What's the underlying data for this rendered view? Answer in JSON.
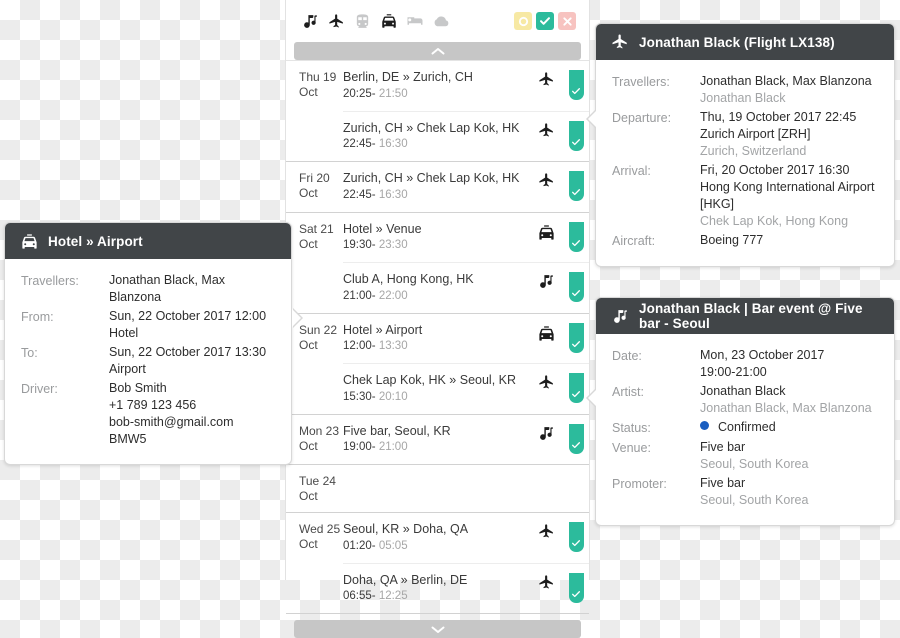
{
  "timeline": {
    "type_filters": [
      {
        "name": "music-note-icon",
        "active": true
      },
      {
        "name": "airplane-icon",
        "active": true
      },
      {
        "name": "train-icon",
        "active": false
      },
      {
        "name": "taxi-icon",
        "active": true
      },
      {
        "name": "bed-icon",
        "active": false
      },
      {
        "name": "cloud-icon",
        "active": false
      }
    ],
    "status_filters": [
      {
        "name": "pending-filter",
        "glyph": "circle",
        "color": "#f7e9a4"
      },
      {
        "name": "confirmed-filter",
        "glyph": "check",
        "color": "#2cbb9c"
      },
      {
        "name": "cancelled-filter",
        "glyph": "cross",
        "color": "#f7c3c0"
      }
    ],
    "scroll_up_label": "▲",
    "scroll_down_label": "▼",
    "days": [
      {
        "date_line1": "Thu 19",
        "date_line2": "Oct",
        "events": [
          {
            "title": "Berlin, DE » Zurich, CH",
            "time_start": "20:25-",
            "time_end": "21:50",
            "type": "airplane-icon",
            "status": "confirmed"
          },
          {
            "title": "Zurich, CH » Chek Lap Kok, HK",
            "time_start": "22:45-",
            "time_end": "16:30",
            "type": "airplane-icon",
            "status": "confirmed"
          }
        ]
      },
      {
        "date_line1": "Fri 20",
        "date_line2": "Oct",
        "events": [
          {
            "title": "Zurich, CH » Chek Lap Kok, HK",
            "time_start": "22:45-",
            "time_end": "16:30",
            "type": "airplane-icon",
            "status": "confirmed"
          }
        ]
      },
      {
        "date_line1": "Sat 21",
        "date_line2": "Oct",
        "events": [
          {
            "title": "Hotel » Venue",
            "time_start": "19:30-",
            "time_end": "23:30",
            "type": "taxi-icon",
            "status": "confirmed"
          },
          {
            "title": "Club A, Hong Kong, HK",
            "time_start": "21:00-",
            "time_end": "22:00",
            "type": "music-note-icon",
            "status": "confirmed"
          }
        ]
      },
      {
        "date_line1": "Sun 22",
        "date_line2": "Oct",
        "events": [
          {
            "title": "Hotel » Airport",
            "time_start": "12:00-",
            "time_end": "13:30",
            "type": "taxi-icon",
            "status": "confirmed"
          },
          {
            "title": "Chek Lap Kok, HK » Seoul, KR",
            "time_start": "15:30-",
            "time_end": "20:10",
            "type": "airplane-icon",
            "status": "confirmed"
          }
        ]
      },
      {
        "date_line1": "Mon 23",
        "date_line2": "Oct",
        "events": [
          {
            "title": "Five bar, Seoul, KR",
            "time_start": "19:00-",
            "time_end": "21:00",
            "type": "music-note-icon",
            "status": "confirmed"
          }
        ]
      },
      {
        "date_line1": "Tue 24",
        "date_line2": "Oct",
        "events": []
      },
      {
        "date_line1": "Wed 25",
        "date_line2": "Oct",
        "events": [
          {
            "title": "Seoul, KR » Doha, QA",
            "time_start": "01:20-",
            "time_end": "05:05",
            "type": "airplane-icon",
            "status": "confirmed"
          },
          {
            "title": "Doha, QA » Berlin, DE",
            "time_start": "06:55-",
            "time_end": "12:25",
            "type": "airplane-icon",
            "status": "confirmed"
          }
        ]
      }
    ]
  },
  "transfer_card": {
    "icon": "taxi-icon",
    "title": "Hotel » Airport",
    "rows": [
      {
        "label": "Travellers:",
        "lines": [
          {
            "text": "Jonathan Black, Max Blanzona",
            "muted": false
          }
        ]
      },
      {
        "label": "From:",
        "lines": [
          {
            "text": "Sun, 22 October 2017 12:00",
            "muted": false
          },
          {
            "text": "Hotel",
            "muted": false
          }
        ]
      },
      {
        "label": "To:",
        "lines": [
          {
            "text": "Sun, 22 October 2017 13:30",
            "muted": false
          },
          {
            "text": "Airport",
            "muted": false
          }
        ]
      },
      {
        "label": "Driver:",
        "lines": [
          {
            "text": "Bob Smith",
            "muted": false
          },
          {
            "text": "+1 789 123 456",
            "muted": false
          },
          {
            "text": "bob-smith@gmail.com",
            "muted": false
          },
          {
            "text": "BMW5",
            "muted": false
          }
        ]
      }
    ]
  },
  "flight_card": {
    "icon": "airplane-icon",
    "title": "Jonathan Black (Flight LX138)",
    "rows": [
      {
        "label": "Travellers:",
        "lines": [
          {
            "text": "Jonathan Black, Max Blanzona",
            "muted": false
          },
          {
            "text": "Jonathan Black",
            "muted": true
          }
        ]
      },
      {
        "label": "Departure:",
        "lines": [
          {
            "text": "Thu, 19 October 2017 22:45",
            "muted": false
          },
          {
            "text": "Zurich Airport [ZRH]",
            "muted": false
          },
          {
            "text": "Zurich, Switzerland",
            "muted": true
          }
        ]
      },
      {
        "label": "Arrival:",
        "lines": [
          {
            "text": "Fri, 20 October 2017 16:30",
            "muted": false
          },
          {
            "text": "Hong Kong International Airport [HKG]",
            "muted": false
          },
          {
            "text": "Chek Lap Kok, Hong Kong",
            "muted": true
          }
        ]
      },
      {
        "label": "Aircraft:",
        "lines": [
          {
            "text": "Boeing 777",
            "muted": false
          }
        ]
      }
    ]
  },
  "event_card": {
    "icon": "music-note-icon",
    "title": "Jonathan Black | Bar event @ Five bar - Seoul",
    "status_color": "#1b5fc1",
    "rows": [
      {
        "label": "Date:",
        "lines": [
          {
            "text": "Mon, 23 October 2017",
            "muted": false
          },
          {
            "text": "19:00-21:00",
            "muted": false
          }
        ]
      },
      {
        "label": "Artist:",
        "lines": [
          {
            "text": "Jonathan Black",
            "muted": false
          },
          {
            "text": "Jonathan Black, Max Blanzona",
            "muted": true
          }
        ]
      },
      {
        "label": "Status:",
        "status": "Confirmed"
      },
      {
        "label": "Venue:",
        "lines": [
          {
            "text": "Five bar",
            "muted": false
          },
          {
            "text": "Seoul, South Korea",
            "muted": true
          }
        ]
      },
      {
        "label": "Promoter:",
        "lines": [
          {
            "text": "Five bar",
            "muted": false
          },
          {
            "text": "Seoul, South Korea",
            "muted": true
          }
        ]
      }
    ]
  }
}
